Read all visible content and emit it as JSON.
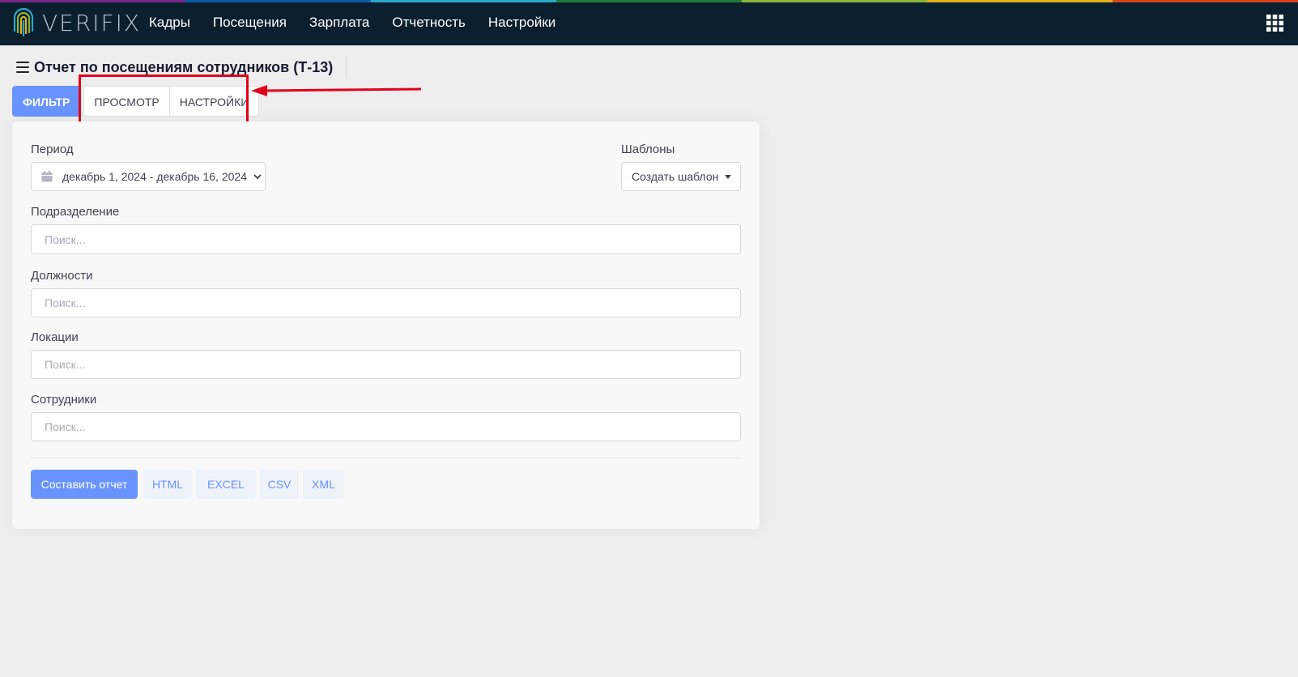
{
  "app": {
    "brand": "VERIFIX",
    "logo_icon": "fingerprint-logo-icon",
    "stripe_colors": [
      "#7b2a8a",
      "#0f5aa8",
      "#2aa7c9",
      "#1e7a3c",
      "#8cb63c",
      "#e2b21c",
      "#d9431e"
    ]
  },
  "nav": {
    "items": [
      "Кадры",
      "Посещения",
      "Зарплата",
      "Отчетность",
      "Настройки"
    ],
    "apps_icon": "grid-apps-icon"
  },
  "page": {
    "title": "Отчет по посещениям сотрудников (Т-13)",
    "menu_icon": "hamburger-menu-icon"
  },
  "tabs": {
    "filter": "ФИЛЬТР",
    "preview": "ПРОСМОТР",
    "settings": "НАСТРОЙКИ"
  },
  "form": {
    "period_label": "Период",
    "period_value": "декабрь 1, 2024 - декабрь 16, 2024",
    "templates_label": "Шаблоны",
    "templates_button": "Создать шаблон",
    "division_label": "Подразделение",
    "division_placeholder": "Поиск...",
    "positions_label": "Должности",
    "positions_placeholder": "Поиск...",
    "locations_label": "Локации",
    "locations_placeholder": "Поиск...",
    "employees_label": "Сотрудники",
    "employees_placeholder": "Поиск..."
  },
  "actions": {
    "build": "Составить отчет",
    "html": "HTML",
    "excel": "EXCEL",
    "csv": "CSV",
    "xml": "XML"
  },
  "colors": {
    "topbar": "#0b1f2e",
    "accent": "#6993ff",
    "annotation": "#e3001b"
  }
}
